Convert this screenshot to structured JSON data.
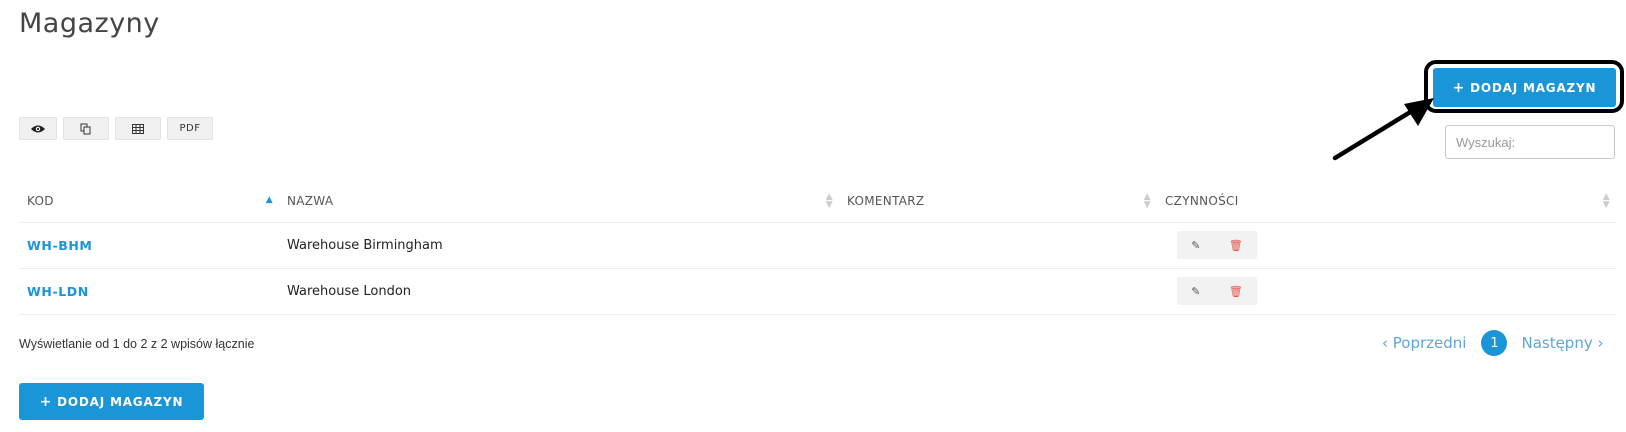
{
  "page": {
    "title": "Magazyny"
  },
  "actions": {
    "add_label": "DODAJ MAGAZYN",
    "add_icon": "plus-icon"
  },
  "toolbar": {
    "view_icon": "eye-icon",
    "copy_icon": "copy-icon",
    "excel_icon": "table-icon",
    "pdf_label": "PDF"
  },
  "search": {
    "placeholder": "Wyszukaj:"
  },
  "table": {
    "columns": [
      "KOD",
      "NAZWA",
      "KOMENTARZ",
      "CZYNNOŚCI"
    ],
    "rows": [
      {
        "code": "WH-BHM",
        "name": "Warehouse Birmingham",
        "comment": ""
      },
      {
        "code": "WH-LDN",
        "name": "Warehouse London",
        "comment": ""
      }
    ],
    "row_actions": {
      "edit_icon": "edit-icon",
      "delete_icon": "trash-icon"
    }
  },
  "footer": {
    "info": "Wyświetlanie od 1 do 2 z 2 wpisów łącznie"
  },
  "pagination": {
    "prev": "Poprzedni",
    "current": "1",
    "next": "Następny"
  },
  "colors": {
    "accent": "#1a95d8",
    "delete": "#e0534a"
  }
}
